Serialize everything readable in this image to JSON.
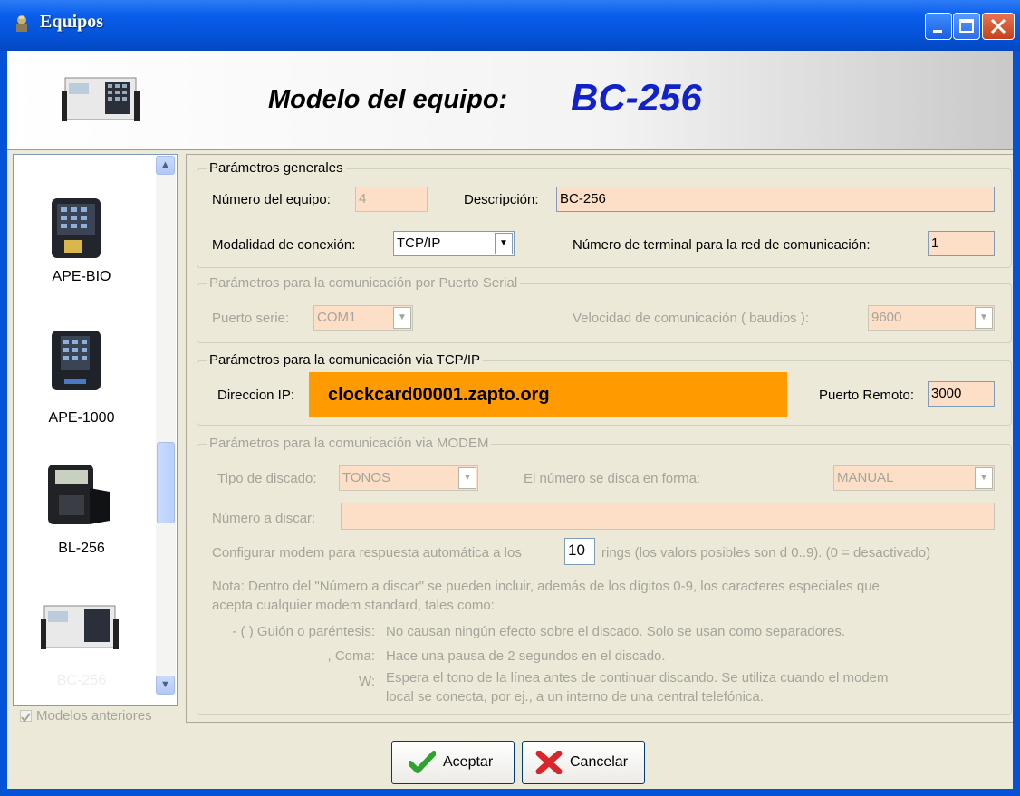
{
  "window": {
    "title": "Equipos"
  },
  "header": {
    "label": "Modelo del equipo:",
    "model": "BC-256"
  },
  "devices": [
    {
      "label": "APE-BIO"
    },
    {
      "label": "APE-1000"
    },
    {
      "label": "BL-256"
    },
    {
      "label": "BC-256"
    }
  ],
  "previous_models": {
    "label": "Modelos anteriores",
    "checked": true
  },
  "general": {
    "legend": "Parámetros generales",
    "number_label": "Número del equipo:",
    "number_value": "4",
    "description_label": "Descripción:",
    "description_value": "BC-256",
    "mode_label": "Modalidad de conexión:",
    "mode_value": "TCP/IP",
    "terminal_label": "Número de terminal para la red de comunicación:",
    "terminal_value": "1"
  },
  "serial": {
    "legend": "Parámetros para la comunicación por Puerto Serial",
    "port_label": "Puerto serie:",
    "port_value": "COM1",
    "speed_label": "Velocidad de comunicación ( baudios ):",
    "speed_value": "9600"
  },
  "tcp": {
    "legend": "Parámetros para la comunicación via TCP/IP",
    "ip_label": "Direccion IP:",
    "ip_value": "clockcard00001.zapto.org",
    "port_label": "Puerto Remoto:",
    "port_value": "3000"
  },
  "modem": {
    "legend": "Parámetros para la comunicación via MODEM",
    "dial_type_label": "Tipo de discado:",
    "dial_type_value": "TONOS",
    "dial_mode_label": "El número se disca en forma:",
    "dial_mode_value": "MANUAL",
    "number_label": "Número a discar:",
    "number_value": "",
    "auto_answer_prefix": "Configurar modem para respuesta automática a los",
    "auto_answer_value": "10",
    "auto_answer_suffix": "rings  (los valors posibles son d 0..9). (0 = desactivado)",
    "note_line1": "Nota: Dentro del \"Número a discar\" se pueden incluir, además de los dígitos 0-9, los caracteres especiales que",
    "note_line2": "acepta cualquier modem standard, tales como:",
    "chars": [
      {
        "key": "- ( ) Guión o paréntesis:",
        "desc1": "No causan ningún efecto sobre el discado. Solo se usan como separadores.",
        "desc2": ""
      },
      {
        "key": ", Coma:",
        "desc1": "Hace una pausa de 2 segundos en el discado.",
        "desc2": ""
      },
      {
        "key": "W:",
        "desc1": "Espera el tono de la línea antes de continuar discando. Se utiliza cuando el modem",
        "desc2": "local se conecta, por ej., a un interno de una central telefónica."
      }
    ]
  },
  "buttons": {
    "accept": "Aceptar",
    "cancel": "Cancelar"
  },
  "colors": {
    "field_bg": "#FCDFC6",
    "highlight": "#FF9A00",
    "model_text": "#1022C8",
    "titlebar": "#0A5EEB"
  }
}
